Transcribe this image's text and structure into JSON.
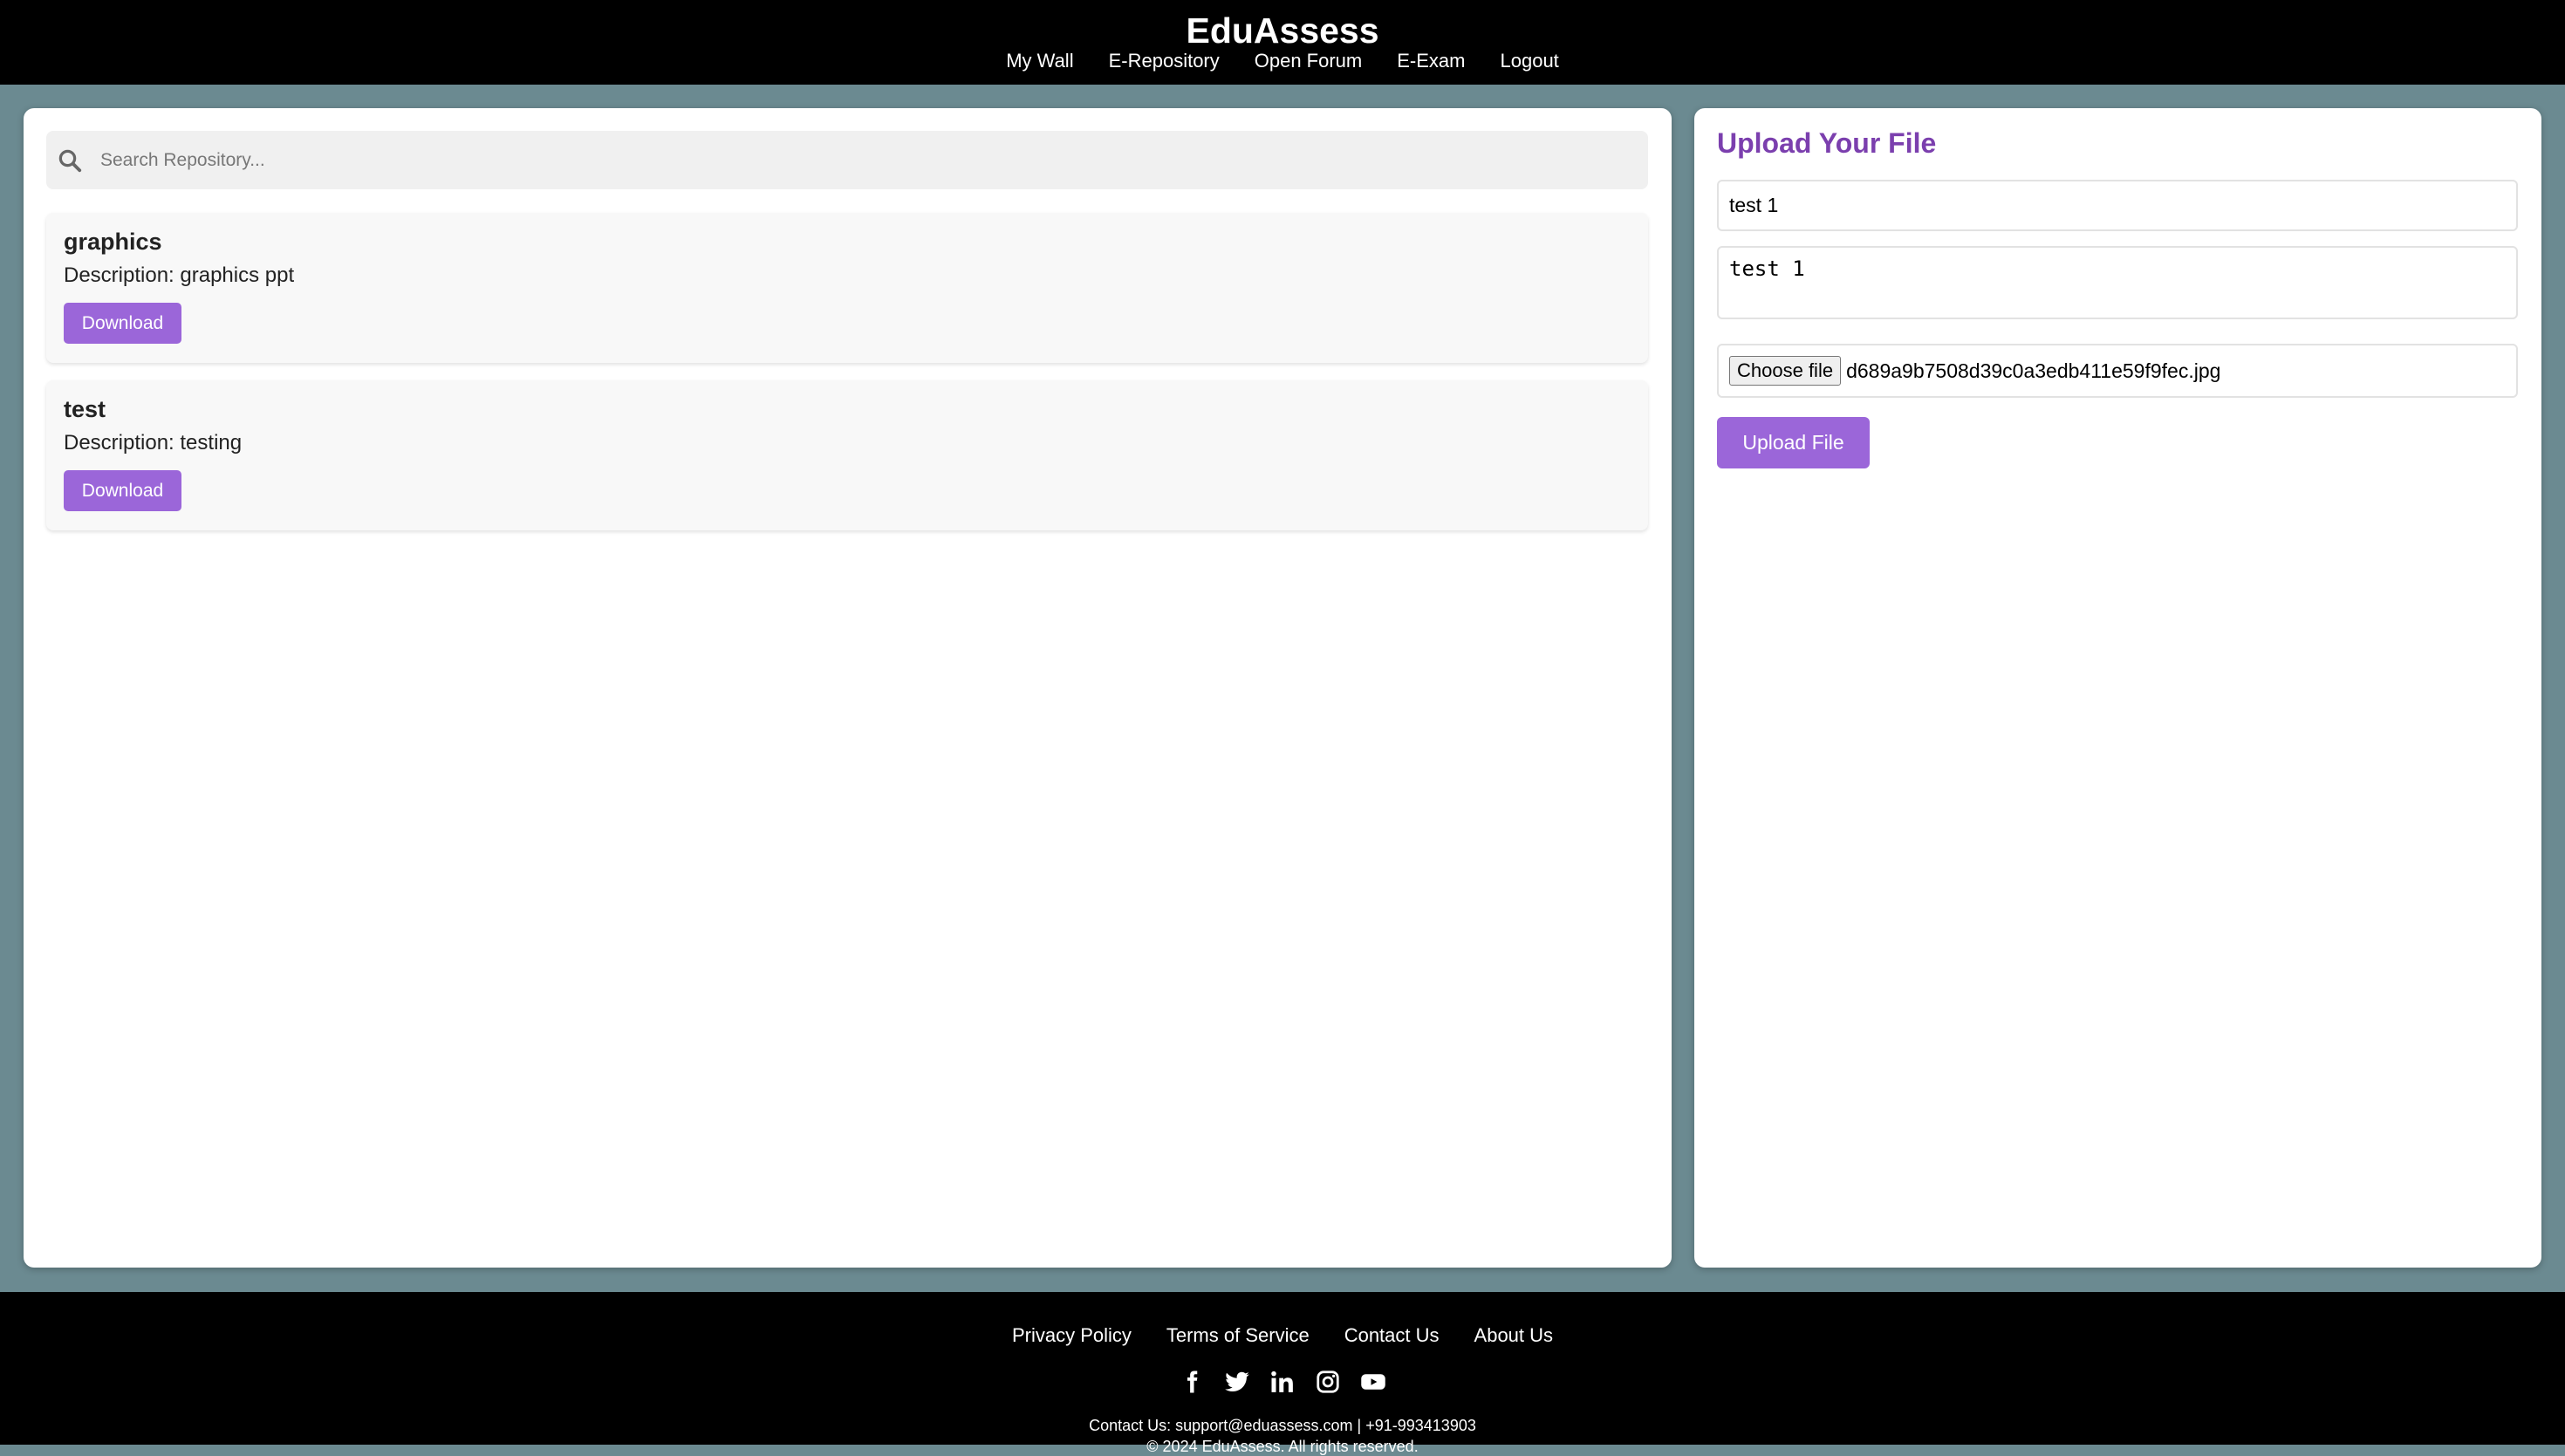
{
  "header": {
    "brand": "EduAssess",
    "nav": [
      "My Wall",
      "E-Repository",
      "Open Forum",
      "E-Exam",
      "Logout"
    ]
  },
  "search": {
    "placeholder": "Search Repository..."
  },
  "repository": {
    "items": [
      {
        "title": "graphics",
        "description": "Description: graphics ppt",
        "download_label": "Download"
      },
      {
        "title": "test",
        "description": "Description: testing",
        "download_label": "Download"
      }
    ]
  },
  "upload": {
    "title": "Upload Your File",
    "name_value": "test 1",
    "description_value": "test 1",
    "choose_label": "Choose file",
    "file_name": "d689a9b7508d39c0a3edb411e59f9fec.jpg",
    "submit_label": "Upload File"
  },
  "footer": {
    "links": [
      "Privacy Policy",
      "Terms of Service",
      "Contact Us",
      "About Us"
    ],
    "social_icons": [
      "facebook-icon",
      "twitter-icon",
      "linkedin-icon",
      "instagram-icon",
      "youtube-icon"
    ],
    "contact": "Contact Us: support@eduassess.com | +91-993413903",
    "copyright": "© 2024 EduAssess. All rights reserved."
  },
  "colors": {
    "accent": "#9b66d9",
    "title_purple": "#7b3fae",
    "background": "#6b8a91"
  }
}
